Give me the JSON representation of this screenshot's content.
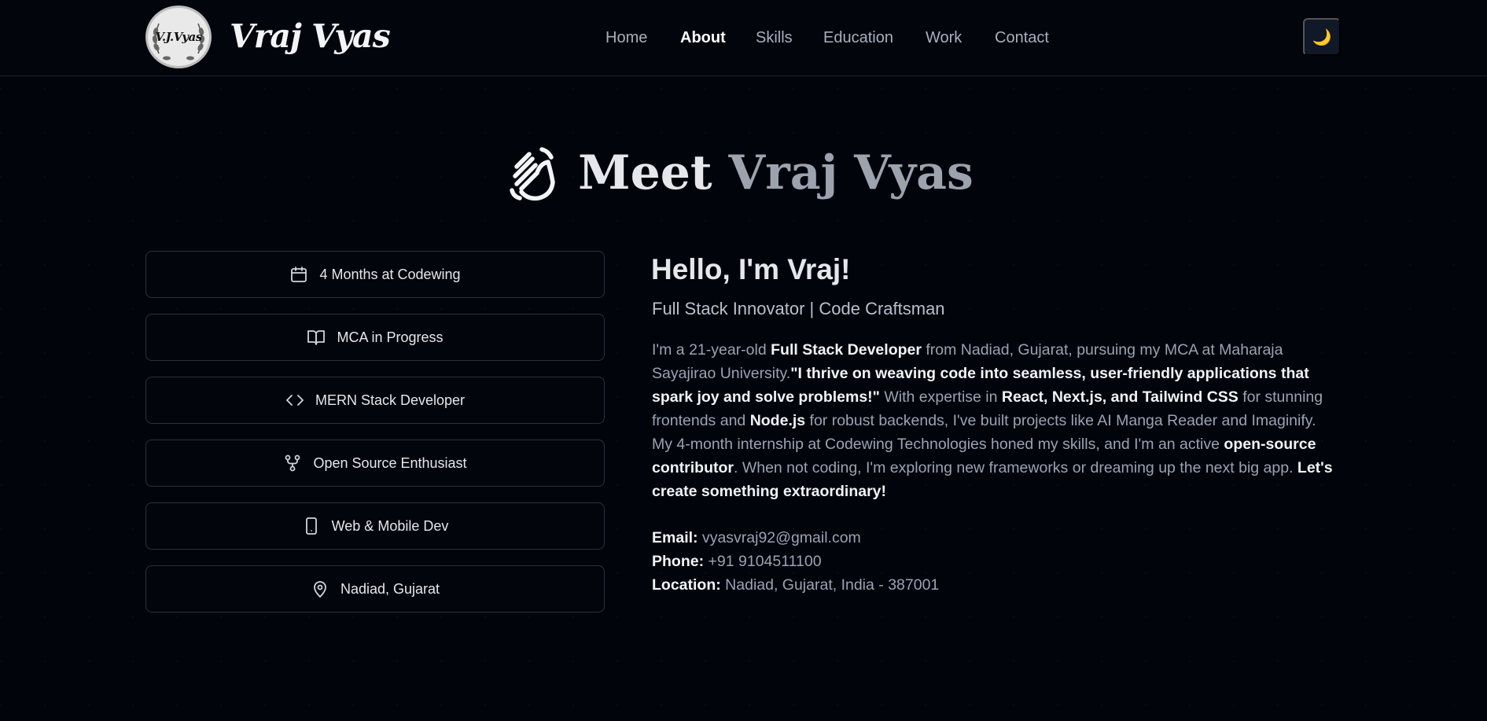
{
  "navbar": {
    "logo_text": "V.J.Vyas",
    "brand_name": "Vraj Vyas",
    "links": [
      {
        "label": "Home",
        "active": false
      },
      {
        "label": "About",
        "active": true
      },
      {
        "label": "Skills",
        "active": false
      },
      {
        "label": "Education",
        "active": false
      },
      {
        "label": "Work",
        "active": false
      },
      {
        "label": "Contact",
        "active": false
      }
    ],
    "theme_toggle_icon": "🌙"
  },
  "about": {
    "heading_prefix": "Meet ",
    "heading_name": "Vraj Vyas",
    "heading_icon": "waving-hand-icon",
    "cards": [
      {
        "icon": "calendar-icon",
        "label": "4 Months at Codewing"
      },
      {
        "icon": "book-open-icon",
        "label": "MCA in Progress"
      },
      {
        "icon": "code-icon",
        "label": "MERN Stack Developer"
      },
      {
        "icon": "git-fork-icon",
        "label": "Open Source Enthusiast"
      },
      {
        "icon": "smartphone-icon",
        "label": "Web & Mobile Dev"
      },
      {
        "icon": "map-pin-icon",
        "label": "Nadiad, Gujarat"
      }
    ],
    "hello": "Hello, I'm Vraj!",
    "subtitle": "Full Stack Innovator | Code Craftsman",
    "bio": {
      "p1": "I'm a 21-year-old ",
      "b1": "Full Stack Developer",
      "p2": " from Nadiad, Gujarat, pursuing my MCA at Maharaja Sayajirao University.",
      "b2": "\"I thrive on weaving code into seamless, user-friendly applications that spark joy and solve problems!\"",
      "p3": " With expertise in ",
      "b3": "React, Next.js, and Tailwind CSS",
      "p4": " for stunning frontends and ",
      "b4": "Node.js",
      "p5": " for robust backends, I've built projects like AI Manga Reader and Imaginify. My 4-month internship at Codewing Technologies honed my skills, and I'm an active ",
      "b5": "open-source contributor",
      "p6": ". When not coding, I'm exploring new frameworks or dreaming up the next big app. ",
      "b6": "Let's create something extraordinary!"
    },
    "contact": {
      "email_label": "Email:",
      "email_value": " vyasvraj92@gmail.com",
      "phone_label": "Phone:",
      "phone_value": " +91 9104511100",
      "location_label": "Location:",
      "location_value": " Nadiad, Gujarat, India - 387001"
    }
  },
  "colors": {
    "background": "#02040c",
    "text_primary": "#e5e7eb",
    "text_muted": "#9aa3b2",
    "card_border": "#2b3040",
    "toggle_bg": "#111827"
  }
}
